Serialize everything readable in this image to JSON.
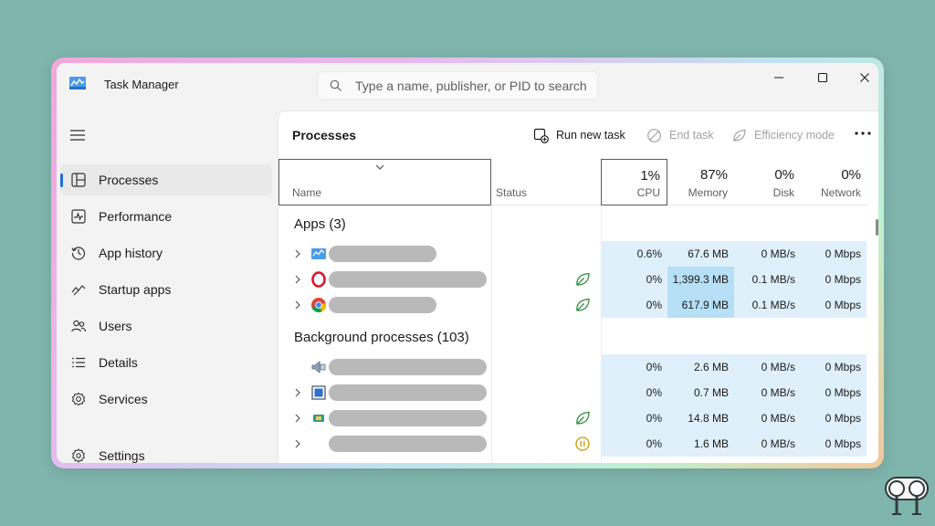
{
  "window": {
    "title": "Task Manager",
    "search_placeholder": "Type a name, publisher, or PID to search"
  },
  "sidebar": {
    "items": [
      {
        "label": "Processes",
        "icon": "processes-icon",
        "active": true
      },
      {
        "label": "Performance",
        "icon": "performance-icon"
      },
      {
        "label": "App history",
        "icon": "app-history-icon"
      },
      {
        "label": "Startup apps",
        "icon": "startup-apps-icon"
      },
      {
        "label": "Users",
        "icon": "users-icon"
      },
      {
        "label": "Details",
        "icon": "details-icon"
      },
      {
        "label": "Services",
        "icon": "services-icon"
      }
    ],
    "settings": {
      "label": "Settings",
      "icon": "settings-icon"
    }
  },
  "main": {
    "title": "Processes",
    "toolbar": {
      "run_new_task": "Run new task",
      "end_task": "End task",
      "efficiency_mode": "Efficiency mode"
    }
  },
  "table": {
    "columns": {
      "name": "Name",
      "status": "Status",
      "cpu": {
        "pct": "1%",
        "label": "CPU"
      },
      "memory": {
        "pct": "87%",
        "label": "Memory"
      },
      "disk": {
        "pct": "0%",
        "label": "Disk"
      },
      "network": {
        "pct": "0%",
        "label": "Network"
      }
    },
    "groups": {
      "apps": "Apps (3)",
      "background": "Background processes (103)"
    },
    "rows": [
      {
        "cpu": "0.6%",
        "memory": "67.6 MB",
        "disk": "0 MB/s",
        "network": "0 Mbps",
        "status": "",
        "icon": "task-manager-icon"
      },
      {
        "cpu": "0%",
        "memory": "1,399.3 MB",
        "disk": "0.1 MB/s",
        "network": "0 Mbps",
        "status": "efficiency-leaf-icon",
        "icon": "opera-icon"
      },
      {
        "cpu": "0%",
        "memory": "617.9 MB",
        "disk": "0.1 MB/s",
        "network": "0 Mbps",
        "status": "efficiency-leaf-icon",
        "icon": "chrome-icon"
      },
      {
        "cpu": "0%",
        "memory": "2.6 MB",
        "disk": "0 MB/s",
        "network": "0 Mbps",
        "status": "",
        "icon": "speaker-icon"
      },
      {
        "cpu": "0%",
        "memory": "0.7 MB",
        "disk": "0 MB/s",
        "network": "0 Mbps",
        "status": "",
        "icon": "window-app-icon"
      },
      {
        "cpu": "0%",
        "memory": "14.8 MB",
        "disk": "0 MB/s",
        "network": "0 Mbps",
        "status": "efficiency-leaf-icon",
        "icon": "app-icon"
      },
      {
        "cpu": "0%",
        "memory": "1.6 MB",
        "disk": "0 MB/s",
        "network": "0 Mbps",
        "status": "paused-icon",
        "icon": ""
      }
    ]
  },
  "colors": {
    "background": "#7fb5ad",
    "accent": "#1f6fd6",
    "cell": "#dff0fb",
    "cell_highlight": "#b7dff5"
  }
}
